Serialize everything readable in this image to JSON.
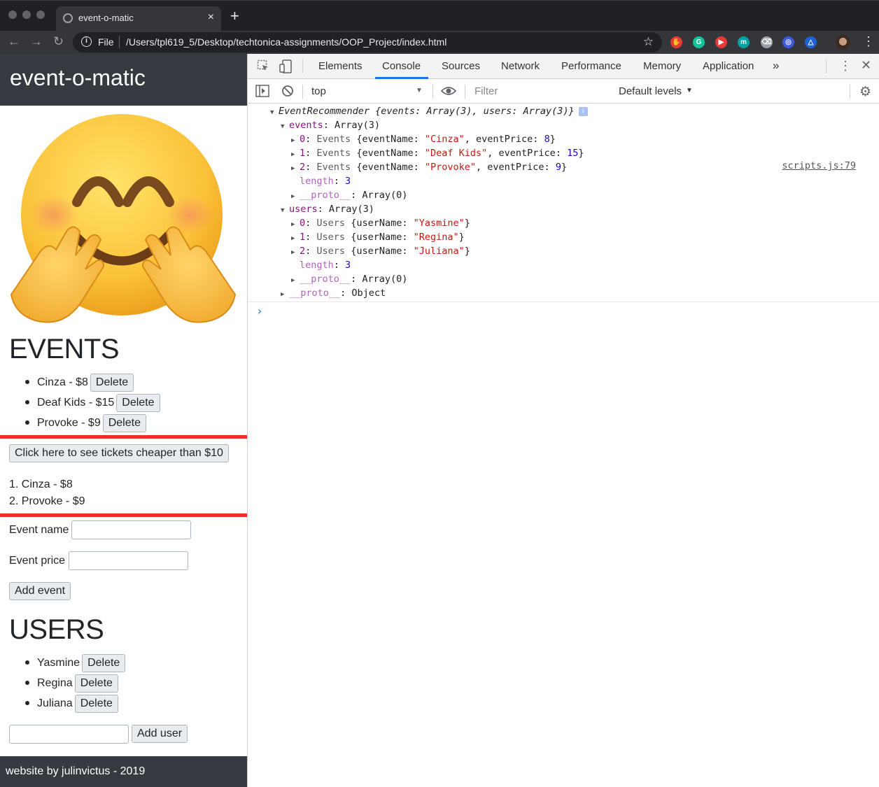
{
  "browser": {
    "tab_title": "event-o-matic",
    "tab_close": "×",
    "new_tab": "+",
    "back": "←",
    "forward": "→",
    "reload": "↻",
    "info": "i",
    "protocol": "File",
    "url": "/Users/tpl619_5/Desktop/techtonica-assignments/OOP_Project/index.html",
    "star": "☆",
    "menu": "⋮",
    "extensions": [
      {
        "name": "hand-extension-icon",
        "color": "#e53935",
        "glyph": "✋"
      },
      {
        "name": "grammarly-extension-icon",
        "color": "#15c39a",
        "glyph": "G"
      },
      {
        "name": "youtube-extension-icon",
        "color": "#e53935",
        "glyph": "▶"
      },
      {
        "name": "m-extension-icon",
        "color": "#00a3a3",
        "glyph": "m"
      },
      {
        "name": "delete-extension-icon",
        "color": "#9aa0a6",
        "glyph": "⌫"
      },
      {
        "name": "ring-extension-icon",
        "color": "#3b5bdb",
        "glyph": "◎"
      },
      {
        "name": "triangle-extension-icon",
        "color": "#1e63d6",
        "glyph": "△"
      }
    ]
  },
  "page": {
    "title": "event-o-matic",
    "events_heading": "EVENTS",
    "events": [
      {
        "label": "Cinza - $8",
        "delete": "Delete"
      },
      {
        "label": "Deaf Kids - $15",
        "delete": "Delete"
      },
      {
        "label": "Provoke - $9",
        "delete": "Delete"
      }
    ],
    "cheap_button": "Click here to see tickets cheaper than $10",
    "cheap_results": [
      "1. Cinza - $8",
      "2. Provoke - $9"
    ],
    "event_name_label": "Event name",
    "event_price_label": "Event price",
    "add_event": "Add event",
    "users_heading": "USERS",
    "users": [
      {
        "label": "Yasmine",
        "delete": "Delete"
      },
      {
        "label": "Regina",
        "delete": "Delete"
      },
      {
        "label": "Juliana",
        "delete": "Delete"
      }
    ],
    "add_user": "Add user",
    "footer": "website by julinvictus - 2019"
  },
  "devtools": {
    "tabs": [
      "Elements",
      "Console",
      "Sources",
      "Network",
      "Performance",
      "Memory",
      "Application"
    ],
    "active_tab": "Console",
    "more_tabs": "»",
    "context": "top",
    "filter_placeholder": "Filter",
    "levels": "Default levels",
    "source_link": "scripts.js:79",
    "console_lines": [
      {
        "indent": 0,
        "tri": "▼",
        "parts": [
          {
            "t": "EventRecommender {events: Array(3), users: Array(3)}",
            "c": "ital"
          }
        ],
        "badge": "i"
      },
      {
        "indent": 1,
        "tri": "▼",
        "parts": [
          {
            "t": "events",
            "c": "k-purple"
          },
          {
            "t": ": Array(3)",
            "c": ""
          }
        ]
      },
      {
        "indent": 2,
        "tri": "▶",
        "parts": [
          {
            "t": "0",
            "c": "k-purple"
          },
          {
            "t": ": ",
            "c": ""
          },
          {
            "t": "Events ",
            "c": "k-gray"
          },
          {
            "t": "{eventName: ",
            "c": ""
          },
          {
            "t": "\"Cinza\"",
            "c": "k-str"
          },
          {
            "t": ", eventPrice: ",
            "c": ""
          },
          {
            "t": "8",
            "c": "k-num"
          },
          {
            "t": "}",
            "c": ""
          }
        ]
      },
      {
        "indent": 2,
        "tri": "▶",
        "parts": [
          {
            "t": "1",
            "c": "k-purple"
          },
          {
            "t": ": ",
            "c": ""
          },
          {
            "t": "Events ",
            "c": "k-gray"
          },
          {
            "t": "{eventName: ",
            "c": ""
          },
          {
            "t": "\"Deaf Kids\"",
            "c": "k-str"
          },
          {
            "t": ", eventPrice: ",
            "c": ""
          },
          {
            "t": "15",
            "c": "k-num"
          },
          {
            "t": "}",
            "c": ""
          }
        ]
      },
      {
        "indent": 2,
        "tri": "▶",
        "parts": [
          {
            "t": "2",
            "c": "k-purple"
          },
          {
            "t": ": ",
            "c": ""
          },
          {
            "t": "Events ",
            "c": "k-gray"
          },
          {
            "t": "{eventName: ",
            "c": ""
          },
          {
            "t": "\"Provoke\"",
            "c": "k-str"
          },
          {
            "t": ", eventPrice: ",
            "c": ""
          },
          {
            "t": "9",
            "c": "k-num"
          },
          {
            "t": "}",
            "c": ""
          }
        ]
      },
      {
        "indent": 2,
        "tri": "",
        "parts": [
          {
            "t": "length",
            "c": "k-light"
          },
          {
            "t": ": ",
            "c": ""
          },
          {
            "t": "3",
            "c": "k-num"
          }
        ]
      },
      {
        "indent": 2,
        "tri": "▶",
        "parts": [
          {
            "t": "__proto__",
            "c": "k-light"
          },
          {
            "t": ": Array(0)",
            "c": ""
          }
        ]
      },
      {
        "indent": 1,
        "tri": "▼",
        "parts": [
          {
            "t": "users",
            "c": "k-purple"
          },
          {
            "t": ": Array(3)",
            "c": ""
          }
        ]
      },
      {
        "indent": 2,
        "tri": "▶",
        "parts": [
          {
            "t": "0",
            "c": "k-purple"
          },
          {
            "t": ": ",
            "c": ""
          },
          {
            "t": "Users ",
            "c": "k-gray"
          },
          {
            "t": "{userName: ",
            "c": ""
          },
          {
            "t": "\"Yasmine\"",
            "c": "k-str"
          },
          {
            "t": "}",
            "c": ""
          }
        ]
      },
      {
        "indent": 2,
        "tri": "▶",
        "parts": [
          {
            "t": "1",
            "c": "k-purple"
          },
          {
            "t": ": ",
            "c": ""
          },
          {
            "t": "Users ",
            "c": "k-gray"
          },
          {
            "t": "{userName: ",
            "c": ""
          },
          {
            "t": "\"Regina\"",
            "c": "k-str"
          },
          {
            "t": "}",
            "c": ""
          }
        ]
      },
      {
        "indent": 2,
        "tri": "▶",
        "parts": [
          {
            "t": "2",
            "c": "k-purple"
          },
          {
            "t": ": ",
            "c": ""
          },
          {
            "t": "Users ",
            "c": "k-gray"
          },
          {
            "t": "{userName: ",
            "c": ""
          },
          {
            "t": "\"Juliana\"",
            "c": "k-str"
          },
          {
            "t": "}",
            "c": ""
          }
        ]
      },
      {
        "indent": 2,
        "tri": "",
        "parts": [
          {
            "t": "length",
            "c": "k-light"
          },
          {
            "t": ": ",
            "c": ""
          },
          {
            "t": "3",
            "c": "k-num"
          }
        ]
      },
      {
        "indent": 2,
        "tri": "▶",
        "parts": [
          {
            "t": "__proto__",
            "c": "k-light"
          },
          {
            "t": ": Array(0)",
            "c": ""
          }
        ]
      },
      {
        "indent": 1,
        "tri": "▶",
        "parts": [
          {
            "t": "__proto__",
            "c": "k-light"
          },
          {
            "t": ": Object",
            "c": ""
          }
        ]
      }
    ],
    "prompt": "›"
  },
  "colors": {
    "highlight_box": "#f22c24",
    "page_header_bg": "#343a40",
    "devtools_accent": "#1a73e8"
  }
}
